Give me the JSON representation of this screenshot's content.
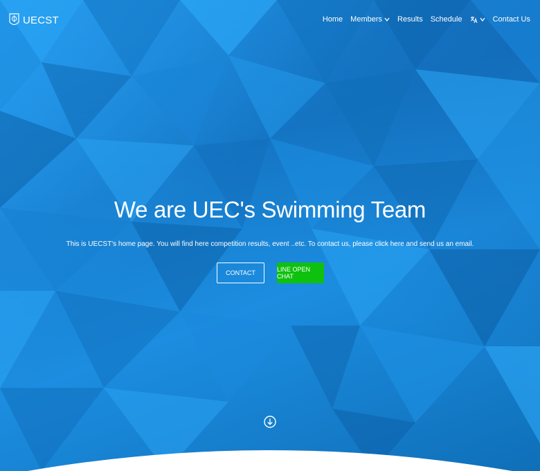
{
  "brand": {
    "name": "UECST",
    "logo_icon": "shield-crest-icon"
  },
  "nav": {
    "home": "Home",
    "members": "Members",
    "results": "Results",
    "schedule": "Schedule",
    "language_icon": "translate-icon",
    "contact": "Contact Us"
  },
  "hero": {
    "title": "We are UEC's Swimming Team",
    "subtitle": "This is UECST's home page. You will find here competition results, event ..etc. To contact us, please click here and send us an email.",
    "contact_button": "CONTACT",
    "line_button": "LINE OPEN CHAT",
    "scroll_icon": "arrow-down-circle-icon"
  },
  "colors": {
    "background": "#1b86d6",
    "line_button": "#0fc10f",
    "text": "#ffffff"
  }
}
